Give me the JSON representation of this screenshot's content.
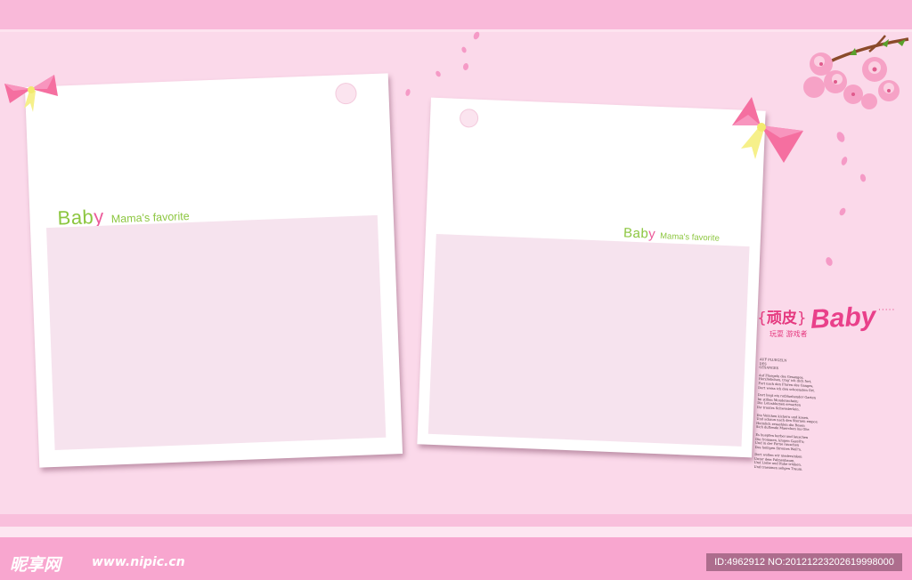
{
  "colors": {
    "background": "#fbd9ea",
    "top_band": "#f9b9d9",
    "bottom_band": "#f8a6cf",
    "card": "#ffffff",
    "photo_area": "#f6e3ee",
    "baby_green": "#8cc63f",
    "accent_pink": "#ec5a9a",
    "stamp_pink": "#e5397f",
    "bow_pink": "#f56fa0",
    "bow_yellow": "#f6f08a"
  },
  "cards": [
    {
      "baby_b": "Bab",
      "baby_y": "y",
      "subtitle": "Mama's favorite"
    },
    {
      "baby_b": "Bab",
      "baby_y": "y",
      "subtitle": "Mama's favorite"
    }
  ],
  "stamp": {
    "bracket_open": "{",
    "title": "顽皮",
    "bracket_close": "}",
    "subtitle": "玩耍 游戏者",
    "baby": "Baby",
    "dots": "·····"
  },
  "tiny_text": {
    "lines": [
      "AUF FLUEGELN",
      "DES",
      "GESANGES",
      "",
      "Auf Fluegeln des Gesanges,",
      "Herzliebchen, trag' ich dich fort,",
      "Fort nach den Fluren des Ganges,",
      "Dort weiss ich den schoensten Ort.",
      "",
      "Dort liegt ein rotbluehender Garten",
      "Im stillen Mondenschein;",
      "Die Lotosblumen erwarten",
      "Ihr trautes Schwesterlein.",
      "",
      "Die Veilchen kichern und kosen,",
      "Und schaun nach den Sternen empor;",
      "Heimlich erzaehlen die Rosen",
      "Sich duftende Maerchen ins Ohr.",
      "",
      "Es huepfen herbei und lauschen",
      "Die frommen, klugen Gazell'n;",
      "Und in der Ferne rauschen",
      "Des heiligen Stromes Well'n.",
      "",
      "Dort wollen wir niedersinken",
      "Unter dem Palmenbaum,",
      "Und Liebe und Ruhe trinken,",
      "Und traeumen seligen Traum."
    ]
  },
  "watermark": {
    "logo": "昵享网",
    "url": "www.nipic.cn",
    "id": "ID:4962912 NO:20121223202619998000"
  }
}
